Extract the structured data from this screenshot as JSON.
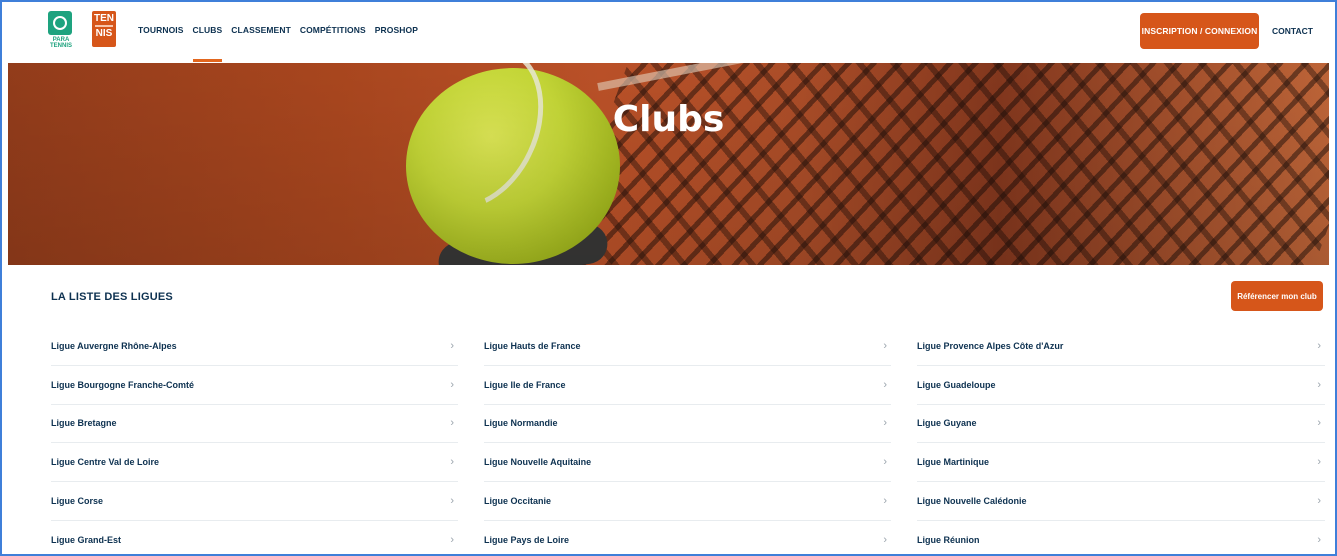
{
  "header": {
    "logo_para_text": "PARA TENNIS",
    "logo_tennis_top": "TEN",
    "logo_tennis_bottom": "NIS",
    "nav": [
      "TOURNOIS",
      "CLUBS",
      "CLASSEMENT",
      "COMPÉTITIONS",
      "PROSHOP"
    ],
    "active_nav": "CLUBS",
    "login_label": "INSCRIPTION / CONNEXION",
    "contact_label": "CONTACT"
  },
  "hero": {
    "title": "Clubs"
  },
  "section": {
    "title": "LA LISTE DES LIGUES",
    "reference_button": "Référencer mon club"
  },
  "leagues": {
    "col1": [
      "Ligue Auvergne Rhône-Alpes",
      "Ligue Bourgogne Franche-Comté",
      "Ligue Bretagne",
      "Ligue Centre Val de Loire",
      "Ligue Corse",
      "Ligue Grand-Est"
    ],
    "col2": [
      "Ligue Hauts de France",
      "Ligue Ile de France",
      "Ligue Normandie",
      "Ligue Nouvelle Aquitaine",
      "Ligue Occitanie",
      "Ligue Pays de Loire"
    ],
    "col3": [
      "Ligue Provence Alpes Côte d'Azur",
      "Ligue Guadeloupe",
      "Ligue Guyane",
      "Ligue Martinique",
      "Ligue Nouvelle Calédonie",
      "Ligue Réunion"
    ]
  },
  "colors": {
    "accent": "#d6561a",
    "navy": "#0d3150",
    "para_green": "#1ea37f"
  },
  "icons": {
    "row_chevron": "chevron-right-icon"
  }
}
